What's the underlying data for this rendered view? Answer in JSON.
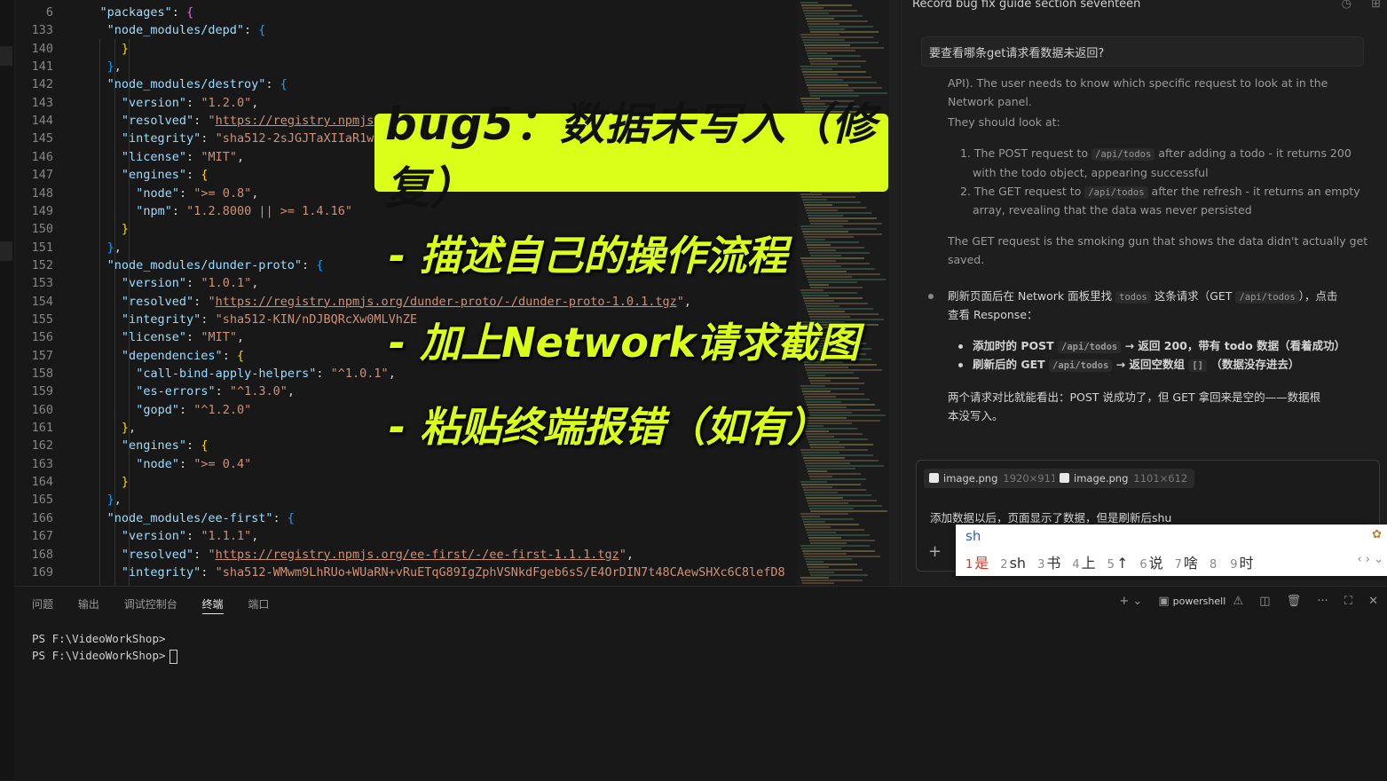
{
  "code_lines": [
    {
      "n": "6",
      "i": 3,
      "parts": [
        [
          "k",
          "\"packages\""
        ],
        [
          "p",
          ": "
        ],
        [
          "b2",
          "{"
        ]
      ]
    },
    {
      "n": "133",
      "i": 4,
      "parts": [
        [
          "k",
          "\"node_modules/depd\""
        ],
        [
          "p",
          ": "
        ],
        [
          "b3",
          "{"
        ]
      ]
    },
    {
      "n": "140",
      "i": 6,
      "parts": [
        [
          "b1",
          "}"
        ]
      ]
    },
    {
      "n": "141",
      "i": 4,
      "parts": [
        [
          "b3",
          "}"
        ],
        [
          "p",
          ","
        ]
      ]
    },
    {
      "n": "142",
      "i": 4,
      "parts": [
        [
          "k",
          "\"node_modules/destroy\""
        ],
        [
          "p",
          ": "
        ],
        [
          "b3",
          "{"
        ]
      ]
    },
    {
      "n": "143",
      "i": 6,
      "parts": [
        [
          "k",
          "\"version\""
        ],
        [
          "p",
          ": "
        ],
        [
          "s",
          "\"1.2.0\""
        ],
        [
          "p",
          ","
        ]
      ]
    },
    {
      "n": "144",
      "i": 6,
      "parts": [
        [
          "k",
          "\"resolved\""
        ],
        [
          "p",
          ": "
        ],
        [
          "s",
          "\""
        ],
        [
          "u",
          "https://registry.npmjs"
        ]
      ]
    },
    {
      "n": "145",
      "i": 6,
      "parts": [
        [
          "k",
          "\"integrity\""
        ],
        [
          "p",
          ": "
        ],
        [
          "s",
          "\"sha512-2sJGJTaXIIaR1w"
        ]
      ]
    },
    {
      "n": "146",
      "i": 6,
      "parts": [
        [
          "k",
          "\"license\""
        ],
        [
          "p",
          ": "
        ],
        [
          "s",
          "\"MIT\""
        ],
        [
          "p",
          ","
        ]
      ]
    },
    {
      "n": "147",
      "i": 6,
      "parts": [
        [
          "k",
          "\"engines\""
        ],
        [
          "p",
          ": "
        ],
        [
          "b1",
          "{"
        ]
      ]
    },
    {
      "n": "148",
      "i": 8,
      "parts": [
        [
          "k",
          "\"node\""
        ],
        [
          "p",
          ": "
        ],
        [
          "s",
          "\">= 0.8\""
        ],
        [
          "p",
          ","
        ]
      ]
    },
    {
      "n": "149",
      "i": 8,
      "parts": [
        [
          "k",
          "\"npm\""
        ],
        [
          "p",
          ": "
        ],
        [
          "s",
          "\"1.2.8000 || >= 1.4.16\""
        ]
      ]
    },
    {
      "n": "150",
      "i": 6,
      "parts": [
        [
          "b1",
          "}"
        ]
      ]
    },
    {
      "n": "151",
      "i": 4,
      "parts": [
        [
          "b3",
          "}"
        ],
        [
          "p",
          ","
        ]
      ]
    },
    {
      "n": "152",
      "i": 4,
      "parts": [
        [
          "k",
          "\"node_modules/dunder-proto\""
        ],
        [
          "p",
          ": "
        ],
        [
          "b3",
          "{"
        ]
      ]
    },
    {
      "n": "153",
      "i": 6,
      "parts": [
        [
          "k",
          "\"version\""
        ],
        [
          "p",
          ": "
        ],
        [
          "s",
          "\"1.0.1\""
        ],
        [
          "p",
          ","
        ]
      ]
    },
    {
      "n": "154",
      "i": 6,
      "parts": [
        [
          "k",
          "\"resolved\""
        ],
        [
          "p",
          ": "
        ],
        [
          "s",
          "\""
        ],
        [
          "u",
          "https://registry.npmjs.org/dunder-proto/-/dunder-proto-1.0.1.tgz"
        ],
        [
          "s",
          "\""
        ],
        [
          "p",
          ","
        ]
      ]
    },
    {
      "n": "155",
      "i": 6,
      "parts": [
        [
          "k",
          "\"integrity\""
        ],
        [
          "p",
          ": "
        ],
        [
          "s",
          "\"sha512-KIN/nDJBQRcXw0MLVhZE"
        ]
      ]
    },
    {
      "n": "156",
      "i": 6,
      "parts": [
        [
          "k",
          "\"license\""
        ],
        [
          "p",
          ": "
        ],
        [
          "s",
          "\"MIT\""
        ],
        [
          "p",
          ","
        ]
      ]
    },
    {
      "n": "157",
      "i": 6,
      "parts": [
        [
          "k",
          "\"dependencies\""
        ],
        [
          "p",
          ": "
        ],
        [
          "b1",
          "{"
        ]
      ]
    },
    {
      "n": "158",
      "i": 8,
      "parts": [
        [
          "k",
          "\"call-bind-apply-helpers\""
        ],
        [
          "p",
          ": "
        ],
        [
          "s",
          "\"^1.0.1\""
        ],
        [
          "p",
          ","
        ]
      ]
    },
    {
      "n": "159",
      "i": 8,
      "parts": [
        [
          "k",
          "\"es-errors\""
        ],
        [
          "p",
          ": "
        ],
        [
          "s",
          "\"^1.3.0\""
        ],
        [
          "p",
          ","
        ]
      ]
    },
    {
      "n": "160",
      "i": 8,
      "parts": [
        [
          "k",
          "\"gopd\""
        ],
        [
          "p",
          ": "
        ],
        [
          "s",
          "\"^1.2.0\""
        ]
      ]
    },
    {
      "n": "161",
      "i": 6,
      "parts": [
        [
          "b1",
          "}"
        ],
        [
          "p",
          ","
        ]
      ]
    },
    {
      "n": "162",
      "i": 6,
      "parts": [
        [
          "k",
          "\"engines\""
        ],
        [
          "p",
          ": "
        ],
        [
          "b1",
          "{"
        ]
      ]
    },
    {
      "n": "163",
      "i": 8,
      "parts": [
        [
          "k",
          "\"node\""
        ],
        [
          "p",
          ": "
        ],
        [
          "s",
          "\">= 0.4\""
        ]
      ]
    },
    {
      "n": "164",
      "i": 6,
      "parts": [
        [
          "b1",
          "}"
        ]
      ]
    },
    {
      "n": "165",
      "i": 4,
      "parts": [
        [
          "b3",
          "}"
        ],
        [
          "p",
          ","
        ]
      ]
    },
    {
      "n": "166",
      "i": 4,
      "parts": [
        [
          "k",
          "\"node_modules/ee-first\""
        ],
        [
          "p",
          ": "
        ],
        [
          "b3",
          "{"
        ]
      ]
    },
    {
      "n": "167",
      "i": 6,
      "parts": [
        [
          "k",
          "\"version\""
        ],
        [
          "p",
          ": "
        ],
        [
          "s",
          "\"1.1.1\""
        ],
        [
          "p",
          ","
        ]
      ]
    },
    {
      "n": "168",
      "i": 6,
      "parts": [
        [
          "k",
          "\"resolved\""
        ],
        [
          "p",
          ": "
        ],
        [
          "s",
          "\""
        ],
        [
          "u",
          "https://registry.npmjs.org/ee-first/-/ee-first-1.1.1.tgz"
        ],
        [
          "s",
          "\""
        ],
        [
          "p",
          ","
        ]
      ]
    },
    {
      "n": "169",
      "i": 6,
      "parts": [
        [
          "k",
          "\"integrity\""
        ],
        [
          "p",
          ": "
        ],
        [
          "s",
          "\"sha512-WMwm9LhRUo+WUaRN+vRuETqG89IgZphVSNkdFgeb6sS/E4OrDIN7t48CAewSHXc6C8lefD8"
        ]
      ]
    }
  ],
  "overlay": {
    "title": "bug5：数据未写入（修复）",
    "items": [
      "- 描述自己的操作流程",
      "- 加上Network请求截图",
      "- 粘贴终端报错（如有）"
    ]
  },
  "chat": {
    "title": "Record bug fix guide section seventeen",
    "user_message": "要查看哪条get请求看数据未返回?",
    "intro_1": "API). The user needs to know which specific request to look at in the",
    "intro_2": "Network panel.",
    "they_should": "They should look at:",
    "step1_a": "1. The POST request to",
    "step1_code": "/api/todos",
    "step1_b": "after adding a todo - it returns 200",
    "step1_c": "with the todo object, appearing successful",
    "step2_a": "2. The GET request to",
    "step2_code": "/api/todos",
    "step2_b": "after the refresh - it returns an empty",
    "step2_c": "array, revealing that the data was never persisted",
    "gun_1": "The GET request is the smoking gun that shows the data didn't actually get",
    "gun_2": "saved.",
    "bullet_a": "刷新页面后在 Network 面板里找",
    "bullet_code1": "todos",
    "bullet_b": "这条请求（GET",
    "bullet_code2": "/api/todos",
    "bullet_c": "），点击",
    "bullet_d": "查看 Response：",
    "sub1_a": "添加时的 POST",
    "sub1_code": "/api/todos",
    "sub1_b": "→ 返回 200，带有 todo 数据（看着成功）",
    "sub2_a": "刷新后的 GET",
    "sub2_code": "/api/todos",
    "sub2_b": "→ 返回空数组",
    "sub2_code2": "[]",
    "sub2_c": "（数据没存进去）",
    "concl_1": "两个请求对比就能看出：POST 说成功了，但 GET 拿回来是空的——数据根",
    "concl_2": "本没写入。",
    "attachments": [
      {
        "name": "image.png",
        "dims": "1920×911"
      },
      {
        "name": "image.png",
        "dims": "1101×612"
      }
    ],
    "input_text": "添加数据以后，页面显示了数据，但是刷新后shu"
  },
  "ime": {
    "composition": "sh",
    "candidates": [
      {
        "n": "1",
        "t": "是"
      },
      {
        "n": "2",
        "t": "sh"
      },
      {
        "n": "3",
        "t": "书"
      },
      {
        "n": "4",
        "t": "上"
      },
      {
        "n": "5",
        "t": "↑"
      },
      {
        "n": "6",
        "t": "说"
      },
      {
        "n": "7",
        "t": "啥"
      },
      {
        "n": "8",
        "t": ""
      },
      {
        "n": "9",
        "t": "时"
      }
    ]
  },
  "panel": {
    "tabs": [
      "问题",
      "输出",
      "调试控制台",
      "终端",
      "端口"
    ],
    "active_tab": "终端",
    "shell_label": "powershell"
  },
  "terminal": {
    "line1": "PS F:\\VideoWorkShop>",
    "line2": "PS F:\\VideoWorkShop>"
  },
  "colors": {
    "accent": "#dcff1a",
    "editor_bg": "#181818",
    "json_key": "#9cdcfe",
    "json_string": "#ce9178"
  },
  "icons": [
    "history-icon",
    "new-chat-icon",
    "plus-icon",
    "terminal-icon",
    "warning-icon",
    "split-icon",
    "trash-icon",
    "more-icon",
    "maximize-icon",
    "close-icon"
  ]
}
